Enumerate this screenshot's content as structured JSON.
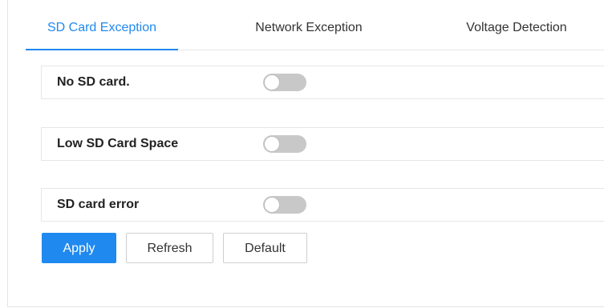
{
  "tabs": [
    {
      "label": "SD Card Exception",
      "active": true
    },
    {
      "label": "Network Exception",
      "active": false
    },
    {
      "label": "Voltage Detection",
      "active": false
    }
  ],
  "settings": [
    {
      "label": "No SD card.",
      "enabled": false
    },
    {
      "label": "Low SD Card Space",
      "enabled": false
    },
    {
      "label": "SD card error",
      "enabled": false
    }
  ],
  "actions": {
    "apply_label": "Apply",
    "refresh_label": "Refresh",
    "default_label": "Default"
  },
  "colors": {
    "accent": "#1f89f0",
    "toggle_off": "#c8c8c8",
    "border": "#e6e6e6"
  }
}
